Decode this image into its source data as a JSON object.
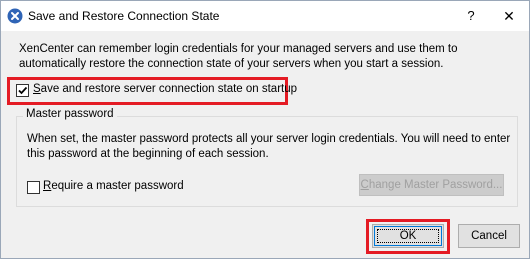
{
  "window": {
    "title": "Save and Restore Connection State",
    "help_label": "?",
    "close_label": "✕"
  },
  "description": "XenCenter can remember login credentials for your managed servers and use them to automatically restore the connection state of your servers when you start a session.",
  "save_restore": {
    "label_prefix": "",
    "label_mnemonic": "S",
    "label_rest": "ave and restore server connection state on startup",
    "checked": true
  },
  "master_password": {
    "group_title": "Master password",
    "description": "When set, the master password protects all your server login credentials. You will need to enter this password at the beginning of each session.",
    "require_mnemonic": "R",
    "require_rest": "equire a master password",
    "require_checked": false,
    "change_mnemonic": "C",
    "change_rest": "hange Master Password..."
  },
  "buttons": {
    "ok_label": "OK",
    "cancel_label": "Cancel"
  },
  "colors": {
    "highlight": "#e41b24",
    "accent": "#0078d7",
    "icon_bg": "#2f64b6"
  }
}
